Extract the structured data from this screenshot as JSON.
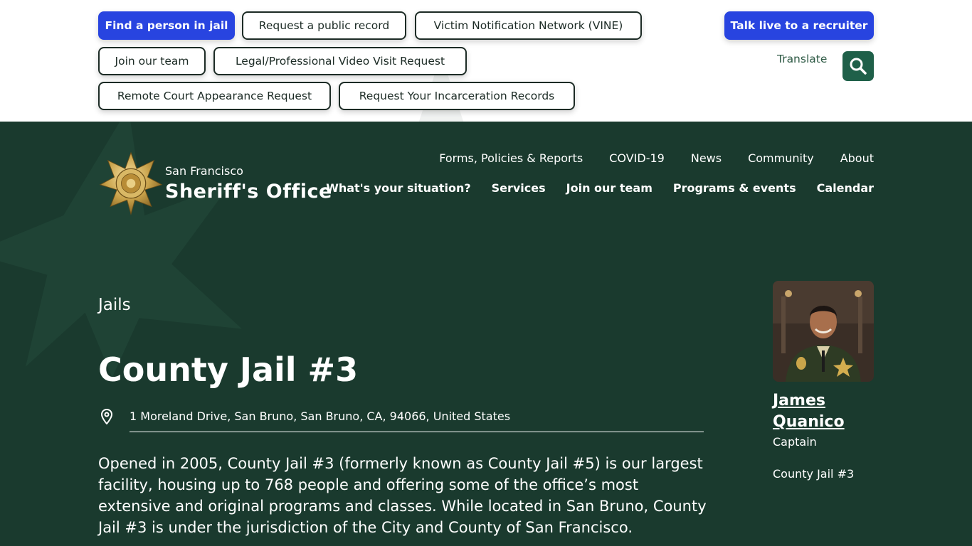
{
  "topbar": {
    "buttons": [
      {
        "label": "Find a person in jail"
      },
      {
        "label": "Request a public record"
      },
      {
        "label": "Victim Notification Network (VINE)"
      },
      {
        "label": "Talk live to a recruiter"
      },
      {
        "label": "Join our team"
      },
      {
        "label": "Legal/Professional Video Visit Request"
      },
      {
        "label": "Remote Court Appearance Request"
      },
      {
        "label": "Request Your Incarceration Records"
      }
    ],
    "translate_label": "Translate",
    "search_icon": "search-icon"
  },
  "brand": {
    "city": "San Francisco",
    "name": "Sheriff's Office",
    "badge_icon": "sheriff-star-badge",
    "badge_color": "#c9a24a"
  },
  "nav": {
    "primary": [
      "Forms, Policies & Reports",
      "COVID-19",
      "News",
      "Community",
      "About"
    ],
    "secondary": [
      "What's your situation?",
      "Services",
      "Join our team",
      "Programs & events",
      "Calendar"
    ]
  },
  "page": {
    "breadcrumb": "Jails",
    "title": "County Jail #3",
    "address": "1 Moreland Drive, San Bruno, San Bruno, CA, 94066, United States",
    "address_icon": "map-pin-icon",
    "description": "Opened in 2005, County Jail #3 (formerly known as County Jail #5) is our largest facility, housing up to 768 people and offering some of the office’s most extensive and original programs and classes. While located in San Bruno, County Jail #3 is under the jurisdiction of the City and County of San Francisco."
  },
  "contact": {
    "name": "James Quanico",
    "rank": "Captain",
    "facility": "County Jail #3"
  },
  "colors": {
    "primary_button": "#2844e0",
    "dark_green": "#1a3a2e",
    "search_green": "#1f6049"
  }
}
